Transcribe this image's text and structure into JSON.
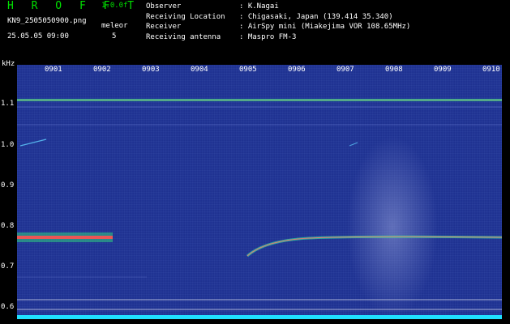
{
  "header": {
    "brand": "H R O F F T",
    "version": "1.0.0f",
    "filename": "KN9_2505050900.png",
    "mode": "meleor",
    "datetime": "25.05.05 09:00",
    "count": "5",
    "info": [
      {
        "key": "Observer",
        "value": ": K.Nagai"
      },
      {
        "key": "Receiving Location",
        "value": ": Chigasaki, Japan (139.414 35.340)"
      },
      {
        "key": "Receiver",
        "value": ": AirSpy mini (Miakejima VOR 108.65MHz)"
      },
      {
        "key": "Receiving antenna",
        "value": ": Maspro FM-3"
      }
    ]
  },
  "axis": {
    "y_unit": "kHz",
    "y_ticks": [
      "1.1",
      "1.0",
      "0.9",
      "0.8",
      "0.7",
      "0.6"
    ],
    "x_ticks": [
      "0901",
      "0902",
      "0903",
      "0904",
      "0905",
      "0906",
      "0907",
      "0908",
      "0909",
      "0910"
    ]
  },
  "colors": {
    "background": "#1a2a8a",
    "signal_line": "#40e0a0",
    "echo": "#ff5050",
    "baseline": "#20e0ff"
  }
}
